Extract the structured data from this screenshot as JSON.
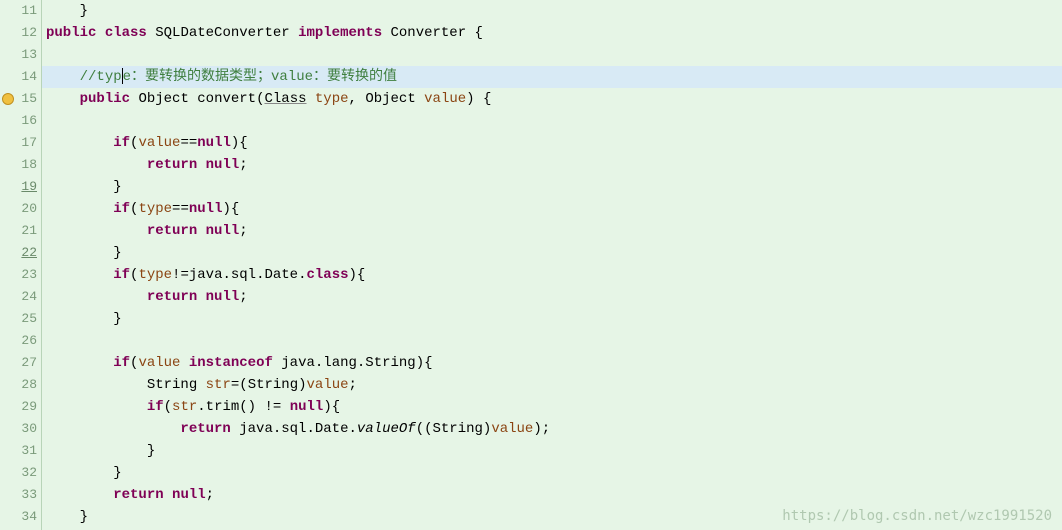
{
  "gutter": {
    "lines": [
      {
        "num": "11",
        "underline": false,
        "icon": null
      },
      {
        "num": "12",
        "underline": false,
        "icon": null
      },
      {
        "num": "13",
        "underline": false,
        "icon": null
      },
      {
        "num": "14",
        "underline": false,
        "icon": null
      },
      {
        "num": "15",
        "underline": false,
        "icon": "warning"
      },
      {
        "num": "16",
        "underline": false,
        "icon": null
      },
      {
        "num": "17",
        "underline": false,
        "icon": null
      },
      {
        "num": "18",
        "underline": false,
        "icon": null
      },
      {
        "num": "19",
        "underline": true,
        "icon": null
      },
      {
        "num": "20",
        "underline": false,
        "icon": null
      },
      {
        "num": "21",
        "underline": false,
        "icon": null
      },
      {
        "num": "22",
        "underline": true,
        "icon": null
      },
      {
        "num": "23",
        "underline": false,
        "icon": null
      },
      {
        "num": "24",
        "underline": false,
        "icon": null
      },
      {
        "num": "25",
        "underline": false,
        "icon": null
      },
      {
        "num": "26",
        "underline": false,
        "icon": null
      },
      {
        "num": "27",
        "underline": false,
        "icon": null
      },
      {
        "num": "28",
        "underline": false,
        "icon": null
      },
      {
        "num": "29",
        "underline": false,
        "icon": null
      },
      {
        "num": "30",
        "underline": false,
        "icon": null
      },
      {
        "num": "31",
        "underline": false,
        "icon": null
      },
      {
        "num": "32",
        "underline": false,
        "icon": null
      },
      {
        "num": "33",
        "underline": false,
        "icon": null
      },
      {
        "num": "34",
        "underline": false,
        "icon": null
      }
    ]
  },
  "code": {
    "l11": {
      "indent": "    ",
      "text": "}"
    },
    "l12": {
      "kw1": "public",
      "sp1": " ",
      "kw2": "class",
      "sp2": " ",
      "cls": "SQLDateConverter",
      "sp3": " ",
      "kw3": "implements",
      "sp4": " ",
      "iface": "Converter",
      "sp5": " ",
      "brace": "{"
    },
    "l13": {
      "text": ""
    },
    "l14": {
      "indent": "    ",
      "comment_pre": "//typ",
      "comment_post": "e：要转换的数据类型；value：要转换的值"
    },
    "l15": {
      "indent": "    ",
      "kw1": "public",
      "sp1": " ",
      "ret": "Object",
      "sp2": " ",
      "method": "convert",
      "p1": "(",
      "t1": "Class",
      "sp3": " ",
      "a1": "type",
      "c1": ", ",
      "t2": "Object",
      "sp4": " ",
      "a2": "value",
      "p2": ")",
      "sp5": " ",
      "brace": "{"
    },
    "l16": {
      "text": ""
    },
    "l17": {
      "indent": "        ",
      "kw": "if",
      "p1": "(",
      "var": "value",
      "op": "==",
      "kw2": "null",
      "p2": ")",
      "brace": "{"
    },
    "l18": {
      "indent": "            ",
      "kw": "return",
      "sp": " ",
      "kw2": "null",
      "semi": ";"
    },
    "l19": {
      "indent": "        ",
      "brace": "}"
    },
    "l20": {
      "indent": "        ",
      "kw": "if",
      "p1": "(",
      "var": "type",
      "op": "==",
      "kw2": "null",
      "p2": ")",
      "brace": "{"
    },
    "l21": {
      "indent": "            ",
      "kw": "return",
      "sp": " ",
      "kw2": "null",
      "semi": ";"
    },
    "l22": {
      "indent": "        ",
      "brace": "}"
    },
    "l23": {
      "indent": "        ",
      "kw": "if",
      "p1": "(",
      "var": "type",
      "op": "!=",
      "pkg": "java.sql.Date.",
      "kw2": "class",
      "p2": ")",
      "brace": "{"
    },
    "l24": {
      "indent": "            ",
      "kw": "return",
      "sp": " ",
      "kw2": "null",
      "semi": ";"
    },
    "l25": {
      "indent": "        ",
      "brace": "}"
    },
    "l26": {
      "text": ""
    },
    "l27": {
      "indent": "        ",
      "kw": "if",
      "p1": "(",
      "var": "value",
      "sp": " ",
      "kw2": "instanceof",
      "sp2": " ",
      "pkg": "java.lang.String",
      "p2": ")",
      "brace": "{"
    },
    "l28": {
      "indent": "            ",
      "type": "String",
      "sp": " ",
      "var": "str",
      "op": "=(",
      "cast": "String",
      "p2": ")",
      "var2": "value",
      "semi": ";"
    },
    "l29": {
      "indent": "            ",
      "kw": "if",
      "p1": "(",
      "var": "str",
      "dot": ".",
      "method": "trim",
      "p2": "()",
      "sp": " ",
      "op": "!=",
      "sp2": " ",
      "kw2": "null",
      "p3": ")",
      "brace": "{"
    },
    "l30": {
      "indent": "                ",
      "kw": "return",
      "sp": " ",
      "pkg": "java.sql.Date.",
      "method": "valueOf",
      "p1": "((",
      "cast": "String",
      "p2": ")",
      "var": "value",
      "p3": ")",
      "semi": ";"
    },
    "l31": {
      "indent": "            ",
      "brace": "}"
    },
    "l32": {
      "indent": "        ",
      "brace": "}"
    },
    "l33": {
      "indent": "        ",
      "kw": "return",
      "sp": " ",
      "kw2": "null",
      "semi": ";"
    },
    "l34": {
      "indent": "    ",
      "brace": "}"
    }
  },
  "watermark": "https://blog.csdn.net/wzc1991520"
}
